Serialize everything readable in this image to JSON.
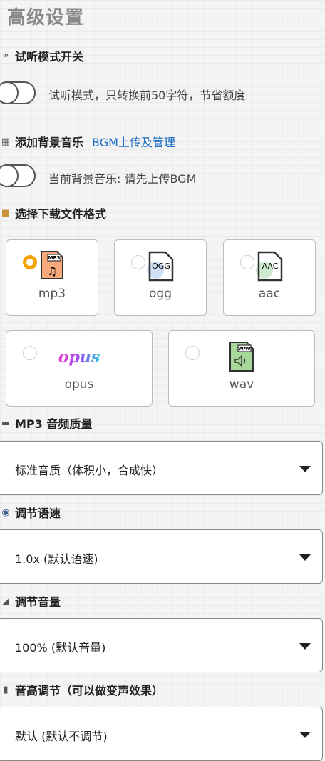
{
  "title": "高级设置",
  "preview": {
    "label": "试听模式开关",
    "toggle_text": "试听模式，只转换前50字符，节省额度",
    "enabled": false
  },
  "bgm": {
    "label": "添加背景音乐",
    "link": "BGM上传及管理",
    "toggle_text": "当前背景音乐: 请先上传BGM",
    "enabled": false
  },
  "format": {
    "label": "选择下载文件格式",
    "options": [
      {
        "name": "mp3",
        "badge": "MP3",
        "selected": true
      },
      {
        "name": "ogg",
        "badge": "OGG",
        "selected": false
      },
      {
        "name": "aac",
        "badge": "AAC",
        "selected": false
      },
      {
        "name": "opus",
        "badge": "opus",
        "selected": false
      },
      {
        "name": "wav",
        "badge": "WAV",
        "selected": false
      }
    ]
  },
  "quality": {
    "label": "MP3 音频质量",
    "value": "标准音质（体积小，合成快）"
  },
  "speed": {
    "label": "调节语速",
    "value": "1.0x (默认语速)"
  },
  "volume": {
    "label": "调节音量",
    "value": "100% (默认音量)"
  },
  "pitch": {
    "label": "音高调节（可以做变声效果）",
    "value": "默认 (默认不调节)"
  }
}
